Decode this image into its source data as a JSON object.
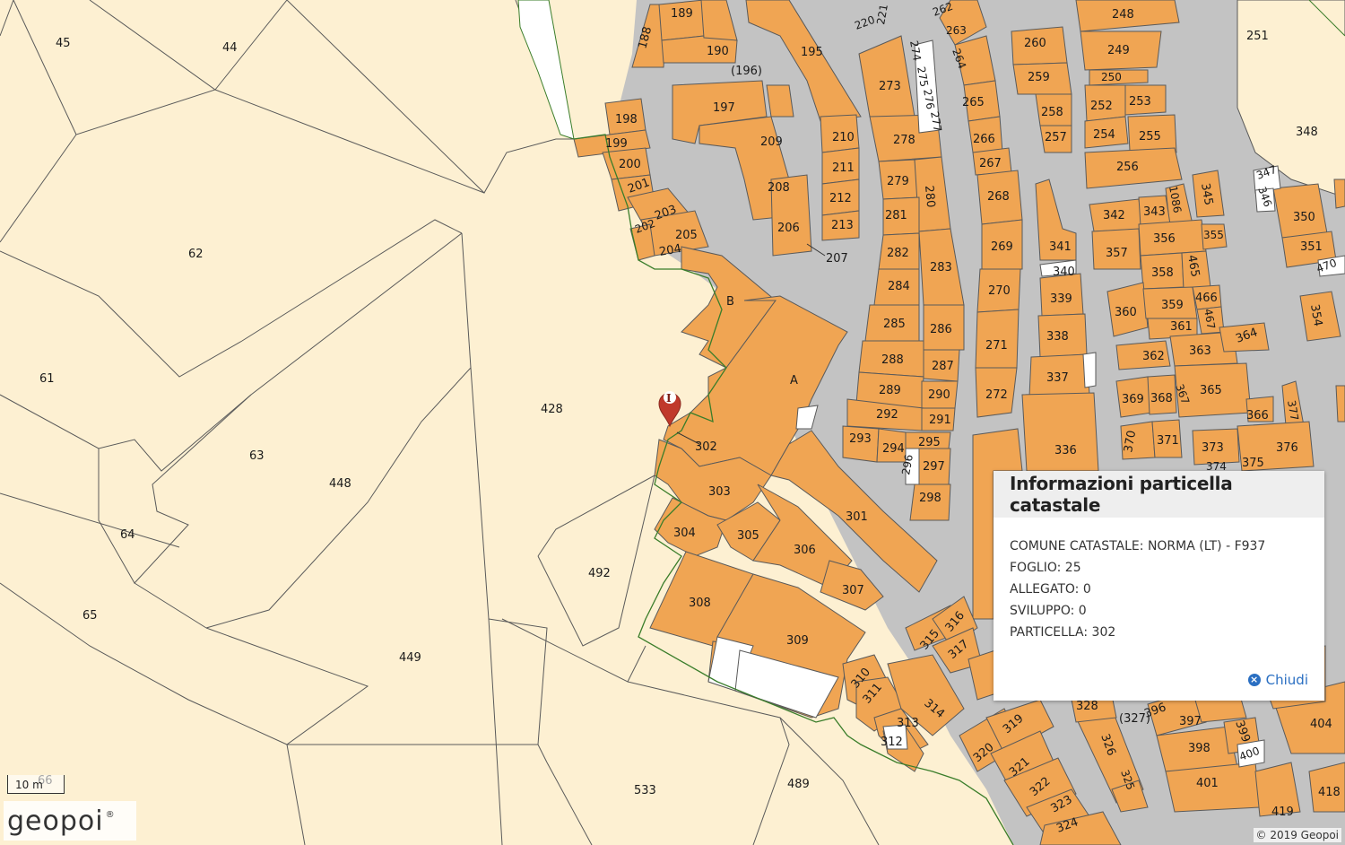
{
  "colors": {
    "rural_parcel": "#fdf0d2",
    "street": "#c3c3c3",
    "building": "#f0a553",
    "outline": "#5a5a5a",
    "selection": "#3a7d2a",
    "marker": "#c0392b",
    "link": "#2a6fc2"
  },
  "parcels": [
    {
      "id": "p45",
      "label": "45"
    },
    {
      "id": "p44",
      "label": "44"
    },
    {
      "id": "p62",
      "label": "62"
    },
    {
      "id": "p61",
      "label": "61"
    },
    {
      "id": "p63",
      "label": "63"
    },
    {
      "id": "p64",
      "label": "64"
    },
    {
      "id": "p65",
      "label": "65"
    },
    {
      "id": "p66",
      "label": "66"
    },
    {
      "id": "p448",
      "label": "448"
    },
    {
      "id": "p449",
      "label": "449"
    },
    {
      "id": "p428",
      "label": "428"
    },
    {
      "id": "p492",
      "label": "492"
    },
    {
      "id": "p533",
      "label": "533"
    },
    {
      "id": "p489",
      "label": "489"
    },
    {
      "id": "p251",
      "label": "251"
    },
    {
      "id": "p348",
      "label": "348"
    }
  ],
  "buildings": [
    "189",
    "188",
    "190",
    "195",
    "220",
    "221",
    "262",
    "263",
    "264",
    "248",
    "249",
    "250",
    "260",
    "259",
    "258",
    "257",
    "196_paren",
    "197",
    "198",
    "199",
    "200",
    "201",
    "202",
    "203",
    "204",
    "205",
    "206",
    "207",
    "208",
    "209",
    "210",
    "211",
    "212",
    "213",
    "273",
    "274",
    "275",
    "276",
    "277",
    "278",
    "279",
    "280",
    "281",
    "282",
    "283",
    "284",
    "285",
    "286",
    "287",
    "288",
    "289",
    "290",
    "291",
    "292",
    "293",
    "294",
    "295",
    "296",
    "297",
    "298",
    "265",
    "266",
    "267",
    "268",
    "269",
    "270",
    "271",
    "272",
    "252",
    "253",
    "254",
    "255",
    "256",
    "341",
    "340",
    "339",
    "338",
    "337",
    "336",
    "342",
    "343",
    "1086",
    "345",
    "346",
    "347",
    "350",
    "351",
    "470",
    "354",
    "355",
    "356",
    "357",
    "358",
    "359",
    "360",
    "361",
    "362",
    "363",
    "364",
    "365",
    "366",
    "367",
    "368",
    "369",
    "370",
    "371",
    "373",
    "374",
    "375",
    "376",
    "377",
    "465",
    "466",
    "467",
    "B",
    "A",
    "302",
    "303",
    "304",
    "305",
    "306",
    "307",
    "301",
    "308",
    "309",
    "310",
    "311",
    "312",
    "313",
    "314",
    "315",
    "316",
    "317",
    "319",
    "320",
    "321",
    "322",
    "323",
    "324",
    "325",
    "326",
    "327_paren",
    "328",
    "396",
    "397",
    "398",
    "399",
    "400",
    "401",
    "404",
    "418",
    "419"
  ],
  "building_labels": {
    "189": "189",
    "188": "188",
    "190": "190",
    "195": "195",
    "220": "220",
    "221": "221",
    "262": "262",
    "263": "263",
    "264": "264",
    "248": "248",
    "249": "249",
    "250": "250",
    "260": "260",
    "259": "259",
    "258": "258",
    "257": "257",
    "196_paren": "(196)",
    "197": "197",
    "198": "198",
    "199": "199",
    "200": "200",
    "201": "201",
    "202": "202",
    "203": "203",
    "204": "204",
    "205": "205",
    "206": "206",
    "207": "207",
    "208": "208",
    "209": "209",
    "210": "210",
    "211": "211",
    "212": "212",
    "213": "213",
    "273": "273",
    "274": "274",
    "275": "275",
    "276": "276",
    "277": "277",
    "278": "278",
    "279": "279",
    "280": "280",
    "281": "281",
    "282": "282",
    "283": "283",
    "284": "284",
    "285": "285",
    "286": "286",
    "287": "287",
    "288": "288",
    "289": "289",
    "290": "290",
    "291": "291",
    "292": "292",
    "293": "293",
    "294": "294",
    "295": "295",
    "296": "296",
    "297": "297",
    "298": "298",
    "265": "265",
    "266": "266",
    "267": "267",
    "268": "268",
    "269": "269",
    "270": "270",
    "271": "271",
    "272": "272",
    "252": "252",
    "253": "253",
    "254": "254",
    "255": "255",
    "256": "256",
    "341": "341",
    "340": "340",
    "339": "339",
    "338": "338",
    "337": "337",
    "336": "336",
    "342": "342",
    "343": "343",
    "1086": "1086",
    "345": "345",
    "346": "346",
    "347": "347",
    "350": "350",
    "351": "351",
    "470": "470",
    "354": "354",
    "355": "355",
    "356": "356",
    "357": "357",
    "358": "358",
    "359": "359",
    "360": "360",
    "361": "361",
    "362": "362",
    "363": "363",
    "364": "364",
    "365": "365",
    "366": "366",
    "367": "367",
    "368": "368",
    "369": "369",
    "370": "370",
    "371": "371",
    "373": "373",
    "374": "374",
    "375": "375",
    "376": "376",
    "377": "377",
    "465": "465",
    "466": "466",
    "467": "467",
    "B": "B",
    "A": "A",
    "302": "302",
    "303": "303",
    "304": "304",
    "305": "305",
    "306": "306",
    "307": "307",
    "301": "301",
    "308": "308",
    "309": "309",
    "310": "310",
    "311": "311",
    "312": "312",
    "313": "313",
    "314": "314",
    "315": "315",
    "316": "316",
    "317": "317",
    "319": "319",
    "320": "320",
    "321": "321",
    "322": "322",
    "323": "323",
    "324": "324",
    "325": "325",
    "326": "326",
    "327_paren": "(327)",
    "328": "328",
    "396": "396",
    "397": "397",
    "398": "398",
    "399": "399",
    "400": "400",
    "401": "401",
    "404": "404",
    "418": "418",
    "419": "419"
  },
  "marker": {
    "icon": "info-marker-icon",
    "glyph": "I"
  },
  "popup": {
    "title": "Informazioni particella catastale",
    "rows": [
      "COMUNE CATASTALE: NORMA (LT) - F937",
      "FOGLIO: 25",
      "ALLEGATO: 0",
      "SVILUPPO: 0",
      "PARTICELLA: 302"
    ],
    "close_label": "Chiudi",
    "close_icon": "close-circle-icon"
  },
  "scale_bar": {
    "label": "10 m"
  },
  "logo": {
    "text": "geopoi",
    "mark": "®"
  },
  "copyright": "© 2019 Geopoi"
}
